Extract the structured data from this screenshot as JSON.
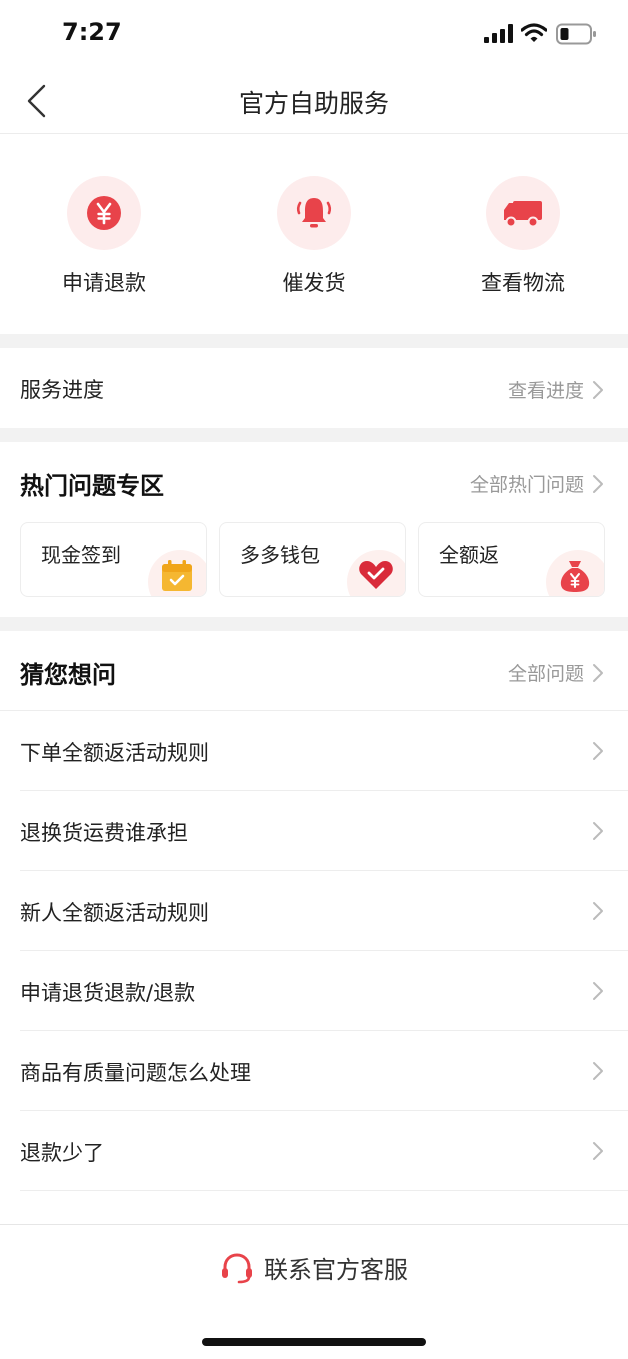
{
  "status_bar": {
    "time": "7:27"
  },
  "nav": {
    "title": "官方自助服务"
  },
  "quick_services": [
    {
      "label": "申请退款",
      "icon": "yuan-coin-icon"
    },
    {
      "label": "催发货",
      "icon": "bell-icon"
    },
    {
      "label": "查看物流",
      "icon": "truck-icon"
    }
  ],
  "service_progress": {
    "title": "服务进度",
    "link": "查看进度"
  },
  "hot": {
    "title": "热门问题专区",
    "link": "全部热门问题",
    "cards": [
      {
        "label": "现金签到",
        "icon": "calendar-check-icon"
      },
      {
        "label": "多多钱包",
        "icon": "heart-wallet-icon"
      },
      {
        "label": "全额返",
        "icon": "money-bag-icon"
      }
    ]
  },
  "guess": {
    "title": "猜您想问",
    "link": "全部问题",
    "items": [
      "下单全额返活动规则",
      "退换货运费谁承担",
      "新人全额返活动规则",
      "申请退货退款/退款",
      "商品有质量问题怎么处理",
      "退款少了"
    ]
  },
  "contact": {
    "label": "联系官方客服"
  },
  "colors": {
    "accent": "#e8434a",
    "icon_bg": "#fdecec",
    "muted": "#999999",
    "calendar": "#f5b731"
  }
}
